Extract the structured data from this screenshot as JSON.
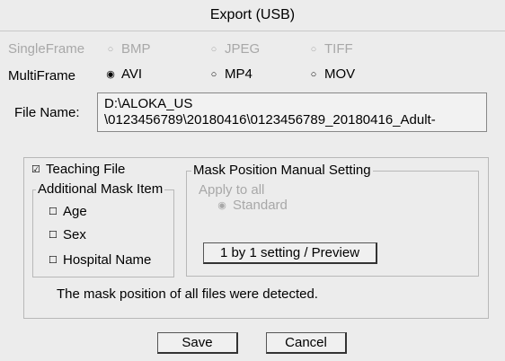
{
  "window": {
    "title": "Export (USB)"
  },
  "single_frame": {
    "label": "SingleFrame",
    "options": [
      "BMP",
      "JPEG",
      "TIFF"
    ]
  },
  "multi_frame": {
    "label": "MultiFrame",
    "options": [
      "AVI",
      "MP4",
      "MOV"
    ],
    "selected": "AVI"
  },
  "file_name": {
    "label": "File Name:",
    "line1": "D:\\ALOKA_US",
    "line2": "\\0123456789\\20180416\\0123456789_20180416_Adult-"
  },
  "teaching_file": {
    "label": "Teaching File",
    "checked": true
  },
  "additional_mask": {
    "title": "Additional Mask Item",
    "items": [
      "Age",
      "Sex",
      "Hospital Name"
    ]
  },
  "mask_position": {
    "title": "Mask Position Manual Setting",
    "apply_all_label": "Apply to all",
    "standard_label": "Standard",
    "setting_button": "1 by 1 setting / Preview"
  },
  "status_message": "The mask position of all files were detected.",
  "buttons": {
    "save": "Save",
    "cancel": "Cancel"
  },
  "icons": {
    "radio_on": "radio-selected-icon",
    "radio_off": "radio-unselected-icon",
    "checkbox": "checkbox-icon"
  }
}
